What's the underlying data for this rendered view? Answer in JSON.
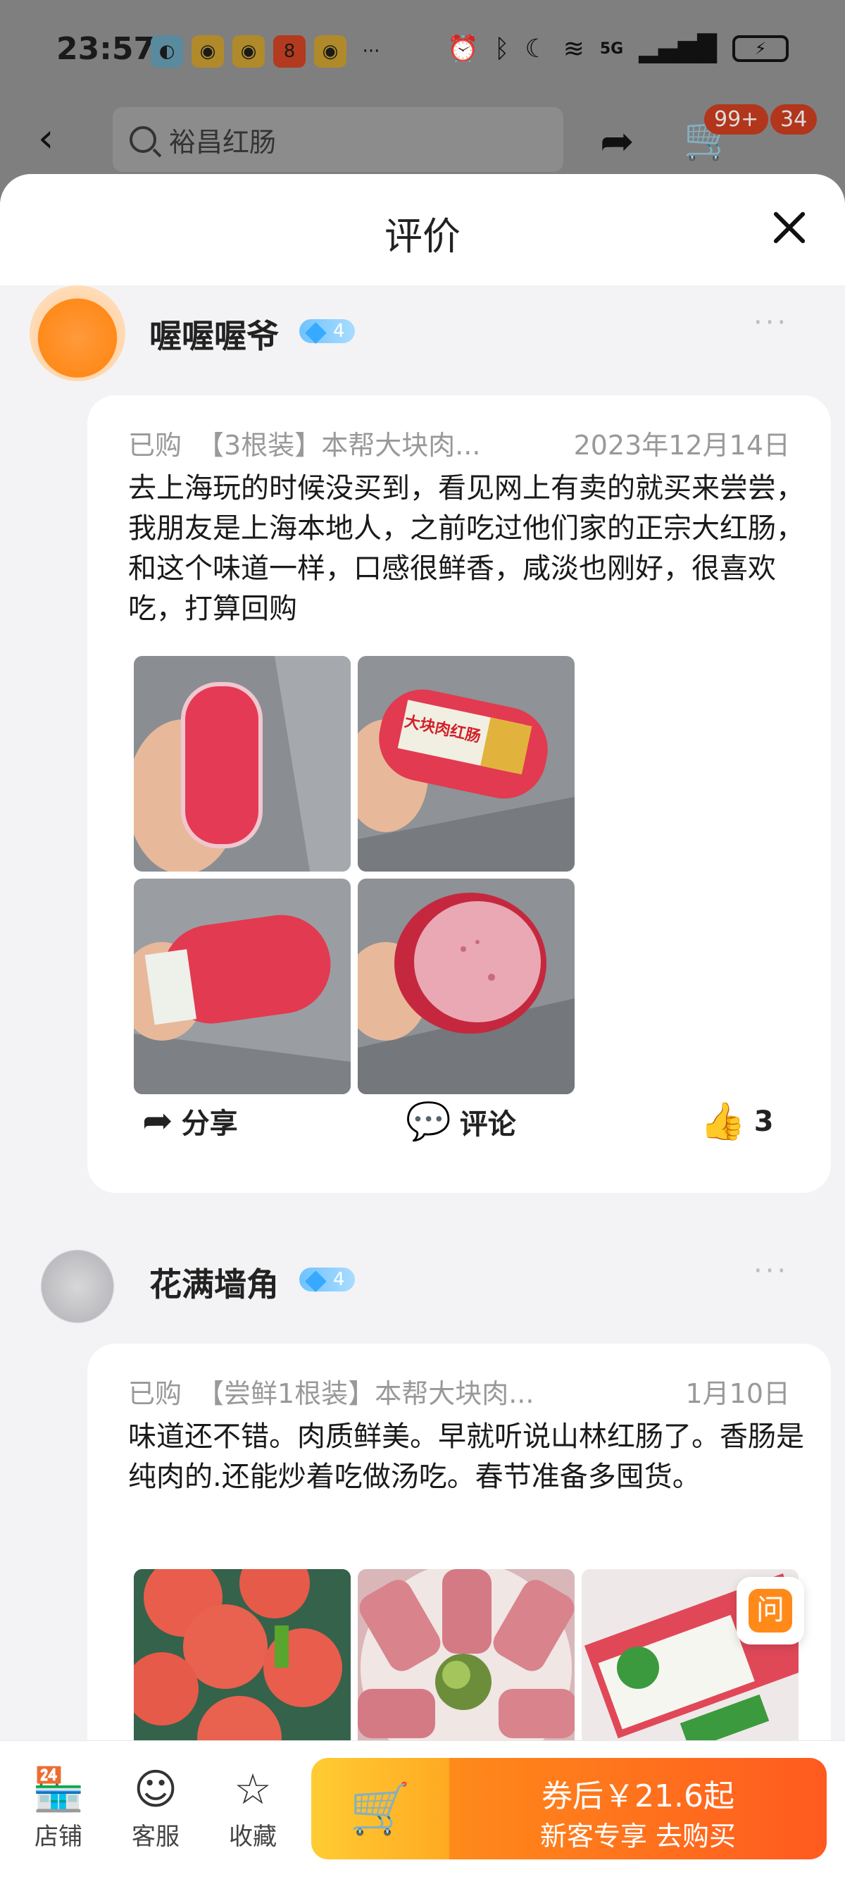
{
  "status": {
    "time": "23:57",
    "network": "5G"
  },
  "nav": {
    "search_text": "裕昌红肠",
    "cart_badge": "99+",
    "msg_badge": "34"
  },
  "sheet": {
    "title": "评价"
  },
  "reviews": [
    {
      "username": "喔喔喔爷",
      "level": "4",
      "bought_label": "已购",
      "product": "【3根装】本帮大块肉...",
      "date": "2023年12月14日",
      "text": "去上海玩的时候没买到，看见网上有卖的就买来尝尝，我朋友是上海本地人，之前吃过他们家的正宗大红肠，和这个味道一样，口感很鲜香，咸淡也刚好，很喜欢吃，打算回购",
      "share_label": "分享",
      "comment_label": "评论",
      "likes": "3"
    },
    {
      "username": "花满墙角",
      "level": "4",
      "bought_label": "已购",
      "product": "【尝鲜1根装】本帮大块肉...",
      "date": "1月10日",
      "text": "味道还不错。肉质鲜美。早就听说山林红肠了。香肠是纯肉的.还能炒着吃做汤吃。春节准备多囤货。"
    }
  ],
  "photos": {
    "package_label": "大块肉红肠"
  },
  "ask_label": "问",
  "bottom": {
    "shop": "店铺",
    "service": "客服",
    "favorite": "收藏",
    "price_line": "券后￥21.6起",
    "sub_line": "新客专享  去购买"
  }
}
